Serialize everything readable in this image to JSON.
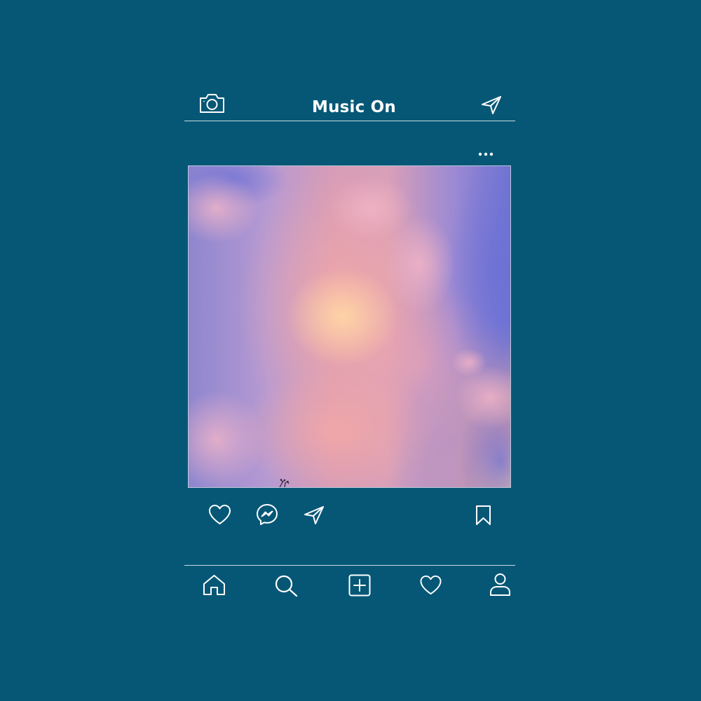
{
  "app": {
    "title": "Music On",
    "background_color": "#065776",
    "foreground_color": "#ffffff"
  },
  "header": {
    "left_icon": "camera-icon",
    "right_icon": "send-icon"
  },
  "post": {
    "menu_icon": "more-options-icon",
    "image_description_icon": "photo",
    "actions": {
      "like_icon": "heart-icon",
      "comment_icon": "messenger-icon",
      "share_icon": "send-icon",
      "save_icon": "bookmark-icon"
    }
  },
  "bottom_nav": {
    "items": [
      {
        "icon": "home-icon"
      },
      {
        "icon": "search-icon"
      },
      {
        "icon": "add-post-icon"
      },
      {
        "icon": "heart-icon"
      },
      {
        "icon": "profile-icon"
      }
    ]
  }
}
